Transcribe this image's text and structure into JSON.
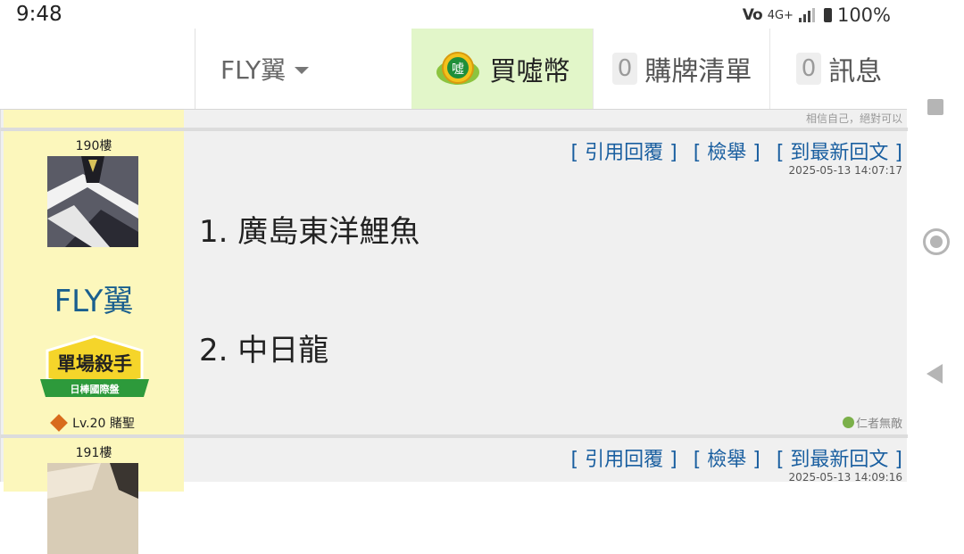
{
  "status_bar": {
    "time": "9:48",
    "volte": "Vo",
    "network": "4G+",
    "battery_pct": "100%"
  },
  "header": {
    "user_menu": "FLY翼",
    "coin_icon_text": "噓",
    "coin_label": "買噓幣",
    "cart_count": "0",
    "cart_label": "購牌清單",
    "msg_count": "0",
    "msg_label": "訊息"
  },
  "prev_post": {
    "signature": "相信自己，絕對可以"
  },
  "posts": [
    {
      "floor": "190樓",
      "username": "FLY翼",
      "badge_title": "單場殺手",
      "badge_sub": "日棒國際盤",
      "level": "Lv.20 賭聖",
      "actions": [
        "[ 引用回覆 ]",
        "[ 檢舉 ]",
        "[ 到最新回文 ]"
      ],
      "date": "2025-05-13 14:07:17",
      "lines": [
        "1. 廣島東洋鯉魚",
        "2. 中日龍"
      ],
      "signature_icon": "仁",
      "signature": "仁者無敵"
    },
    {
      "floor": "191樓",
      "actions": [
        "[ 引用回覆 ]",
        "[ 檢舉 ]",
        "[ 到最新回文 ]"
      ],
      "date": "2025-05-13 14:09:16"
    }
  ],
  "colors": {
    "sidebar_bg": "#fcf7bc",
    "coin_tab_bg": "#e2f6c9",
    "link": "#1a5fa0",
    "username": "#1a5f8e"
  }
}
